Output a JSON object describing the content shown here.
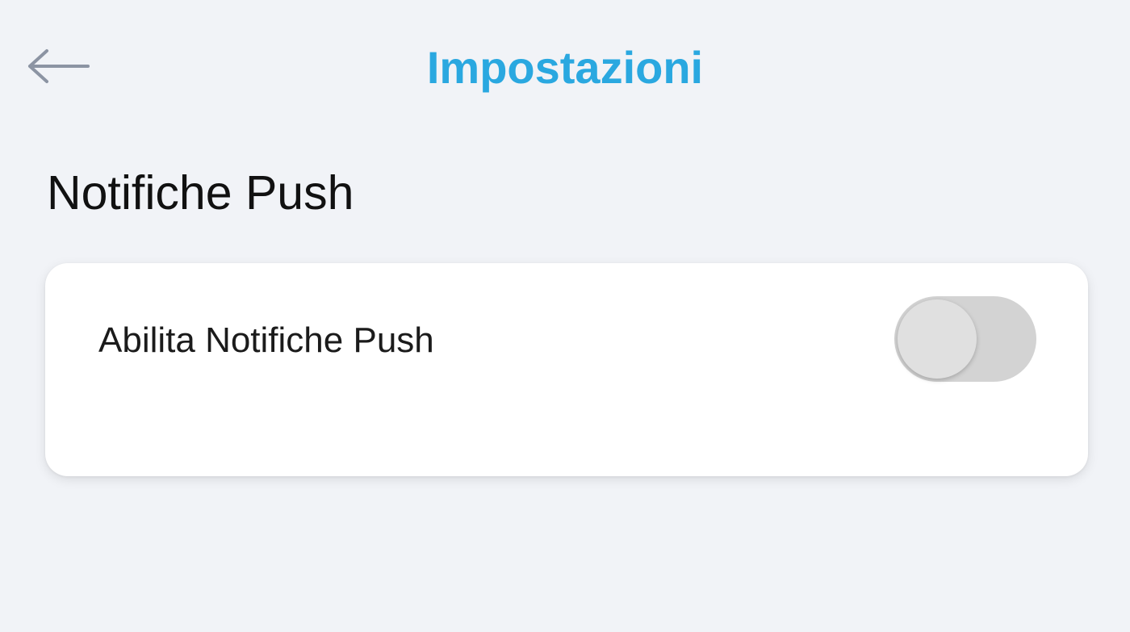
{
  "header": {
    "title": "Impostazioni",
    "back_icon": "arrow-left-icon",
    "title_color": "#2aa8e0"
  },
  "section": {
    "title": "Notifiche Push"
  },
  "settings": {
    "items": [
      {
        "label": "Abilita Notifiche Push",
        "control": "toggle",
        "enabled": false
      }
    ]
  },
  "colors": {
    "background": "#f1f3f7",
    "card": "#ffffff",
    "toggle_track_off": "#d3d3d3",
    "toggle_knob": "#e0e0e0"
  }
}
